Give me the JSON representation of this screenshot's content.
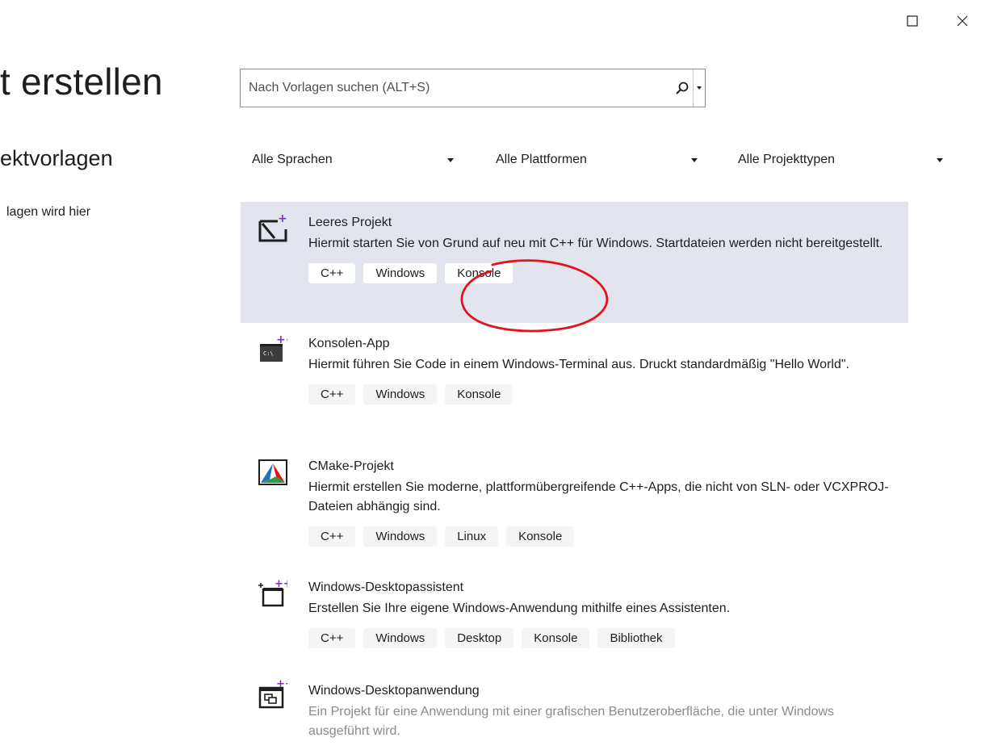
{
  "page": {
    "title": "t erstellen",
    "section_title": "ektvorlagen",
    "recent_text": "lagen wird hier"
  },
  "search": {
    "placeholder": "Nach Vorlagen suchen (ALT+S)"
  },
  "filters": {
    "language": "Alle Sprachen",
    "platform": "Alle Plattformen",
    "project_type": "Alle Projekttypen"
  },
  "templates": [
    {
      "name": "Leeres Projekt",
      "description": "Hiermit starten Sie von Grund auf neu mit C++ für Windows. Startdateien werden nicht bereitgestellt.",
      "tags": [
        "C++",
        "Windows",
        "Konsole"
      ],
      "icon": "empty-project-icon",
      "selected": true
    },
    {
      "name": "Konsolen-App",
      "description": "Hiermit führen Sie Code in einem Windows-Terminal aus. Druckt standardmäßig \"Hello World\".",
      "tags": [
        "C++",
        "Windows",
        "Konsole"
      ],
      "icon": "console-app-icon"
    },
    {
      "name": "CMake-Projekt",
      "description": "Hiermit erstellen Sie moderne, plattformübergreifende C++-Apps, die nicht von SLN- oder VCXPROJ-Dateien abhängig sind.",
      "tags": [
        "C++",
        "Windows",
        "Linux",
        "Konsole"
      ],
      "icon": "cmake-icon"
    },
    {
      "name": "Windows-Desktopassistent",
      "description": "Erstellen Sie Ihre eigene Windows-Anwendung mithilfe eines Assistenten.",
      "tags": [
        "C++",
        "Windows",
        "Desktop",
        "Konsole",
        "Bibliothek"
      ],
      "icon": "desktop-wizard-icon"
    },
    {
      "name": "Windows-Desktopanwendung",
      "description": "Ein Projekt für eine Anwendung mit einer grafischen Benutzeroberfläche, die unter Windows ausgeführt wird.",
      "tags": [],
      "icon": "desktop-app-icon"
    }
  ],
  "colors": {
    "selected_bg": "#e3e5ee",
    "annotation": "#e3121b",
    "cpp_plus": "#7b2fbe"
  }
}
